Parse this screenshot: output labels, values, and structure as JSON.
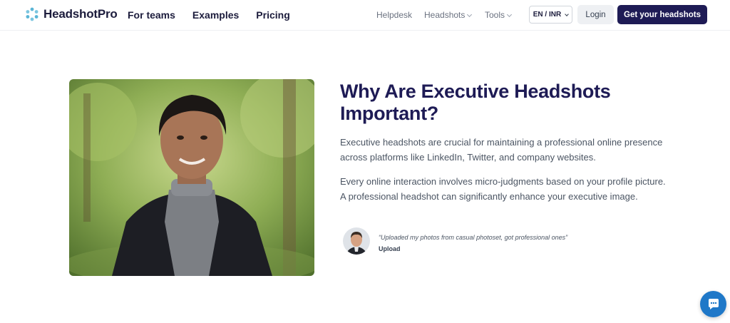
{
  "header": {
    "brand": "HeadshotPro",
    "nav": [
      {
        "label": "For teams"
      },
      {
        "label": "Examples"
      },
      {
        "label": "Pricing"
      }
    ],
    "helpdesk": "Helpdesk",
    "headshots": "Headshots",
    "tools": "Tools",
    "language": "EN / INR",
    "login": "Login",
    "cta": "Get your headshots"
  },
  "section": {
    "title": "Why Are Executive Headshots Important?",
    "paragraph1": "Executive headshots are crucial for maintaining a professional online presence across platforms like LinkedIn, Twitter, and company websites.",
    "paragraph2": "Every online interaction involves micro-judgments based on your profile picture. A professional headshot can significantly enhance your executive image.",
    "testimonial": {
      "quote": "“Uploaded my photos from casual photoset, got professional ones”",
      "label": "Upload"
    }
  },
  "icons": {
    "logo": "headshotpro-logo-icon",
    "chat": "chat-bubble-icon"
  },
  "colors": {
    "brand_navy": "#1e1b55",
    "chat_blue": "#1f78c8",
    "logo_teal": "#5ab5d6"
  }
}
